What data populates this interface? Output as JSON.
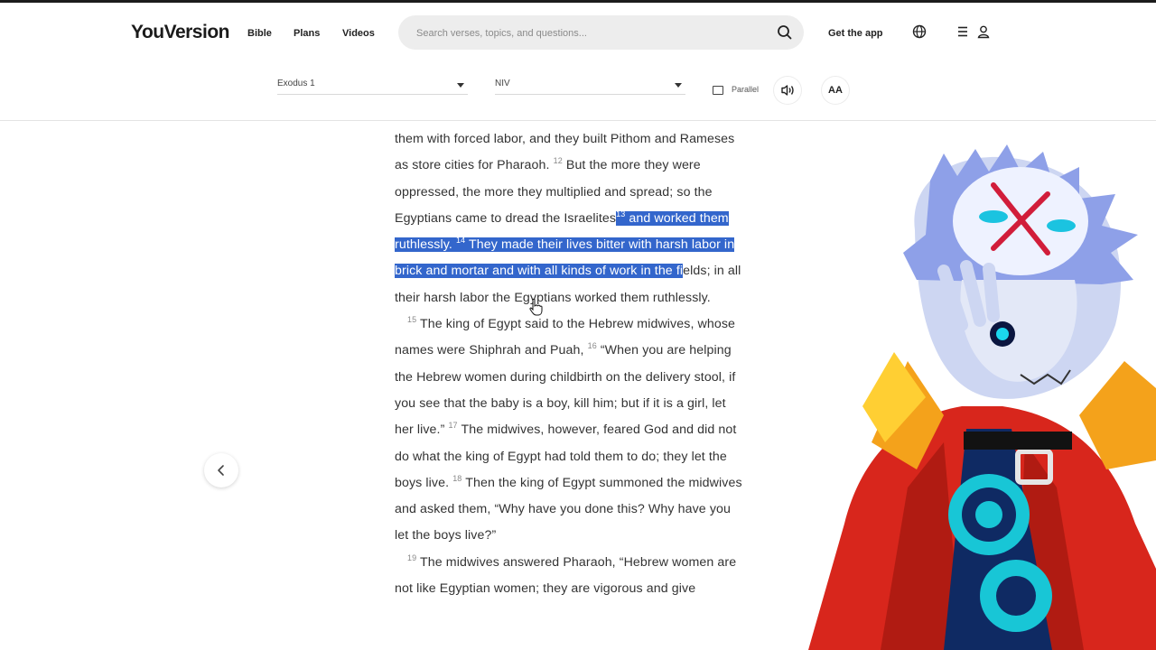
{
  "brand": {
    "logo": "YouVersion"
  },
  "nav": {
    "links": [
      "Bible",
      "Plans",
      "Videos"
    ],
    "search_placeholder": "Search verses, topics, and questions...",
    "get_app": "Get the app"
  },
  "toolbar": {
    "book_select": "Exodus 1",
    "version_select": "NIV",
    "parallel_label": "Parallel",
    "font_size_label": "AA"
  },
  "reader": {
    "p1_a": "them with forced labor, and they built Pithom and Rameses as store cities for Pharaoh.",
    "v12": "12",
    "p1_b": "But the more they were oppressed, the more they multiplied and spread; so the Egyptians came to dread the Israelites",
    "v13": "13",
    "p1_c": "and worked them ruthlessly.",
    "v14": "14",
    "p1_d": "They made their lives bitter with harsh labor in brick and mortar and with all kinds of work in the fi",
    "p1_e": "elds; in all their harsh labor the Egyptians worked them ruthlessly.",
    "v15": "15",
    "p2_a": "The king of Egypt said to the Hebrew midwives, whose names were Shiphrah and Puah,",
    "v16": "16",
    "p2_b": "“When you are helping the Hebrew women during childbirth on the delivery stool, if you see that the baby is a boy, kill him; but if it is a girl, let her live.”",
    "v17": "17",
    "p2_c": "The midwives, however, feared God and did not do what the king of Egypt had told them to do; they let the boys live.",
    "v18": "18",
    "p2_d": "Then the king of Egypt summoned the midwives and asked them, “Why have you done this? Why have you let the boys live?”",
    "v19": "19",
    "p3_a": "The midwives answered Pharaoh, “Hebrew women are not like Egyptian women; they are vigorous and give"
  },
  "icons": [
    "search-icon",
    "globe-icon",
    "menu-icon",
    "user-icon",
    "parallel-icon",
    "audio-icon",
    "chevron-left-icon"
  ],
  "colors": {
    "highlight": "#3366cc",
    "search_bg": "#ededed",
    "text": "#333333"
  }
}
